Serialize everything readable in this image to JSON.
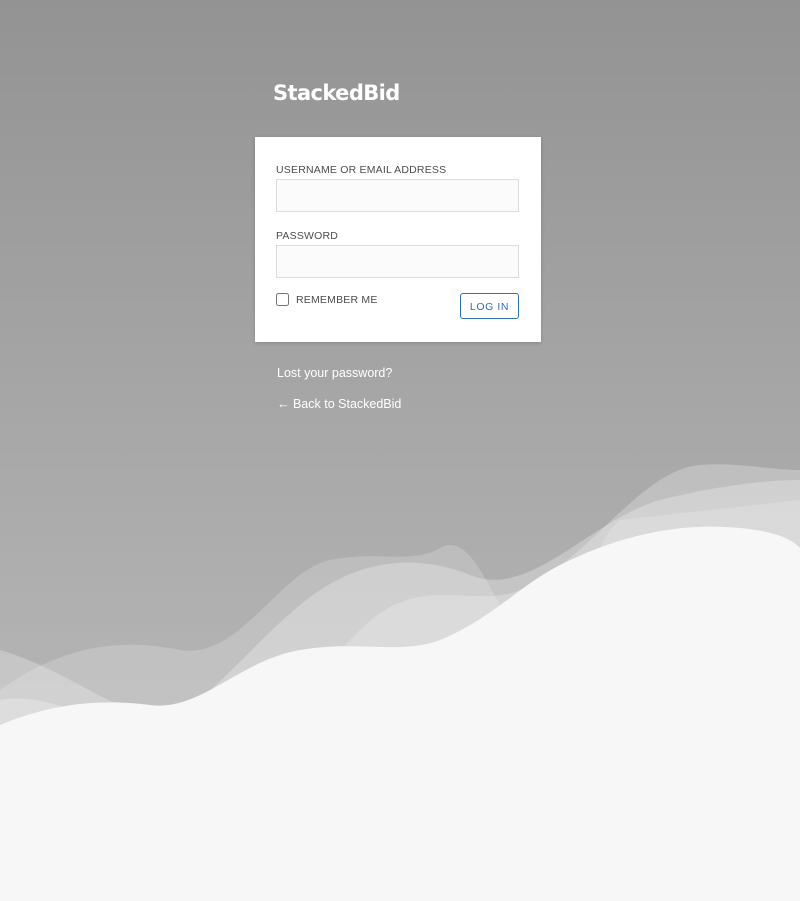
{
  "brand": {
    "name": "StackedBid"
  },
  "login_form": {
    "username_label": "USERNAME OR EMAIL ADDRESS",
    "username_value": "",
    "password_label": "PASSWORD",
    "password_value": "",
    "remember_label": "REMEMBER ME",
    "remember_checked": false,
    "submit_label": "LOG IN"
  },
  "links": {
    "lost_password": "Lost your password?",
    "back_to_site": "← Back to StackedBid"
  },
  "colors": {
    "background_gradient_top": "#939393",
    "background_gradient_bottom": "#bdbdbd",
    "background_light": "#f7f7f7",
    "card": "#ffffff",
    "accent": "#2f6fb3",
    "label_text": "#4c4c4c"
  }
}
